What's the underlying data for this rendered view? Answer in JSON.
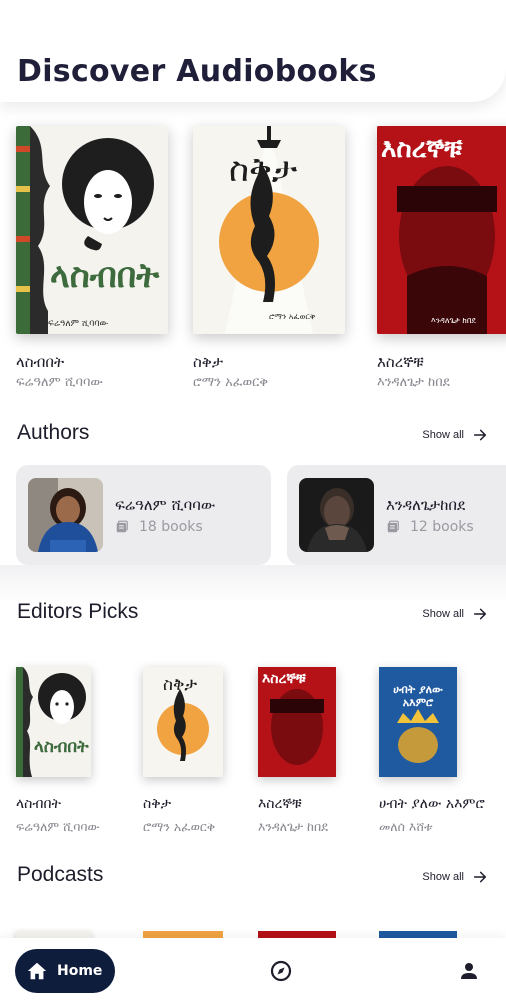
{
  "header": {
    "title": "Discover Audiobooks"
  },
  "featured": [
    {
      "title": "ላስብበት",
      "author": "ፍሬዓለም ሺባባው",
      "cover_text": "ላስብበት",
      "cover_sub": "ፍሬዓለም ሺባባው"
    },
    {
      "title": "ስቅታ",
      "author": "ሮማን አፈወርቅ",
      "cover_text": "ስቅታ",
      "cover_sub": "ሮማን አፈወርቅ"
    },
    {
      "title": "እስረኞቹ",
      "author": "እንዳለጌታ ከበደ",
      "cover_text": "እስረኞቹ",
      "cover_sub": "እንዳለጌታ ከበደ"
    }
  ],
  "authors_section": {
    "title": "Authors",
    "show_all": "Show all",
    "items": [
      {
        "name": "ፍሬዓለም ሺባባው",
        "books": "18 books"
      },
      {
        "name": "እንዳለጌታከበደ",
        "books": "12 books"
      }
    ]
  },
  "editors_section": {
    "title": "Editors Picks",
    "show_all": "Show all",
    "items": [
      {
        "title": "ላስብበት",
        "author": "ፍሬዓለም ሺባባው",
        "cover_text": "ላስብበት"
      },
      {
        "title": "ስቅታ",
        "author": "ሮማን አፈወርቅ",
        "cover_text": "ስቅታ"
      },
      {
        "title": "እስረኞቹ",
        "author": "እንዳለጌታ ከበደ",
        "cover_text": "እስረኞቹ"
      },
      {
        "title": "ሀብት ያለው አእምሮ",
        "author": "መለሰ እሸቱ",
        "cover_text": "ሀብት ያለው አእምሮ"
      }
    ]
  },
  "podcasts_section": {
    "title": "Podcasts",
    "show_all": "Show all"
  },
  "bottom_nav": {
    "home_label": "Home",
    "home_icon": "home-icon",
    "explore_icon": "compass-icon",
    "profile_icon": "person-icon"
  },
  "colors": {
    "nav_active": "#0f1d3d",
    "card_bg": "#ececee",
    "book_red": "#c8161d",
    "book_orange": "#f0a340",
    "book_blue": "#1f5aa0"
  }
}
